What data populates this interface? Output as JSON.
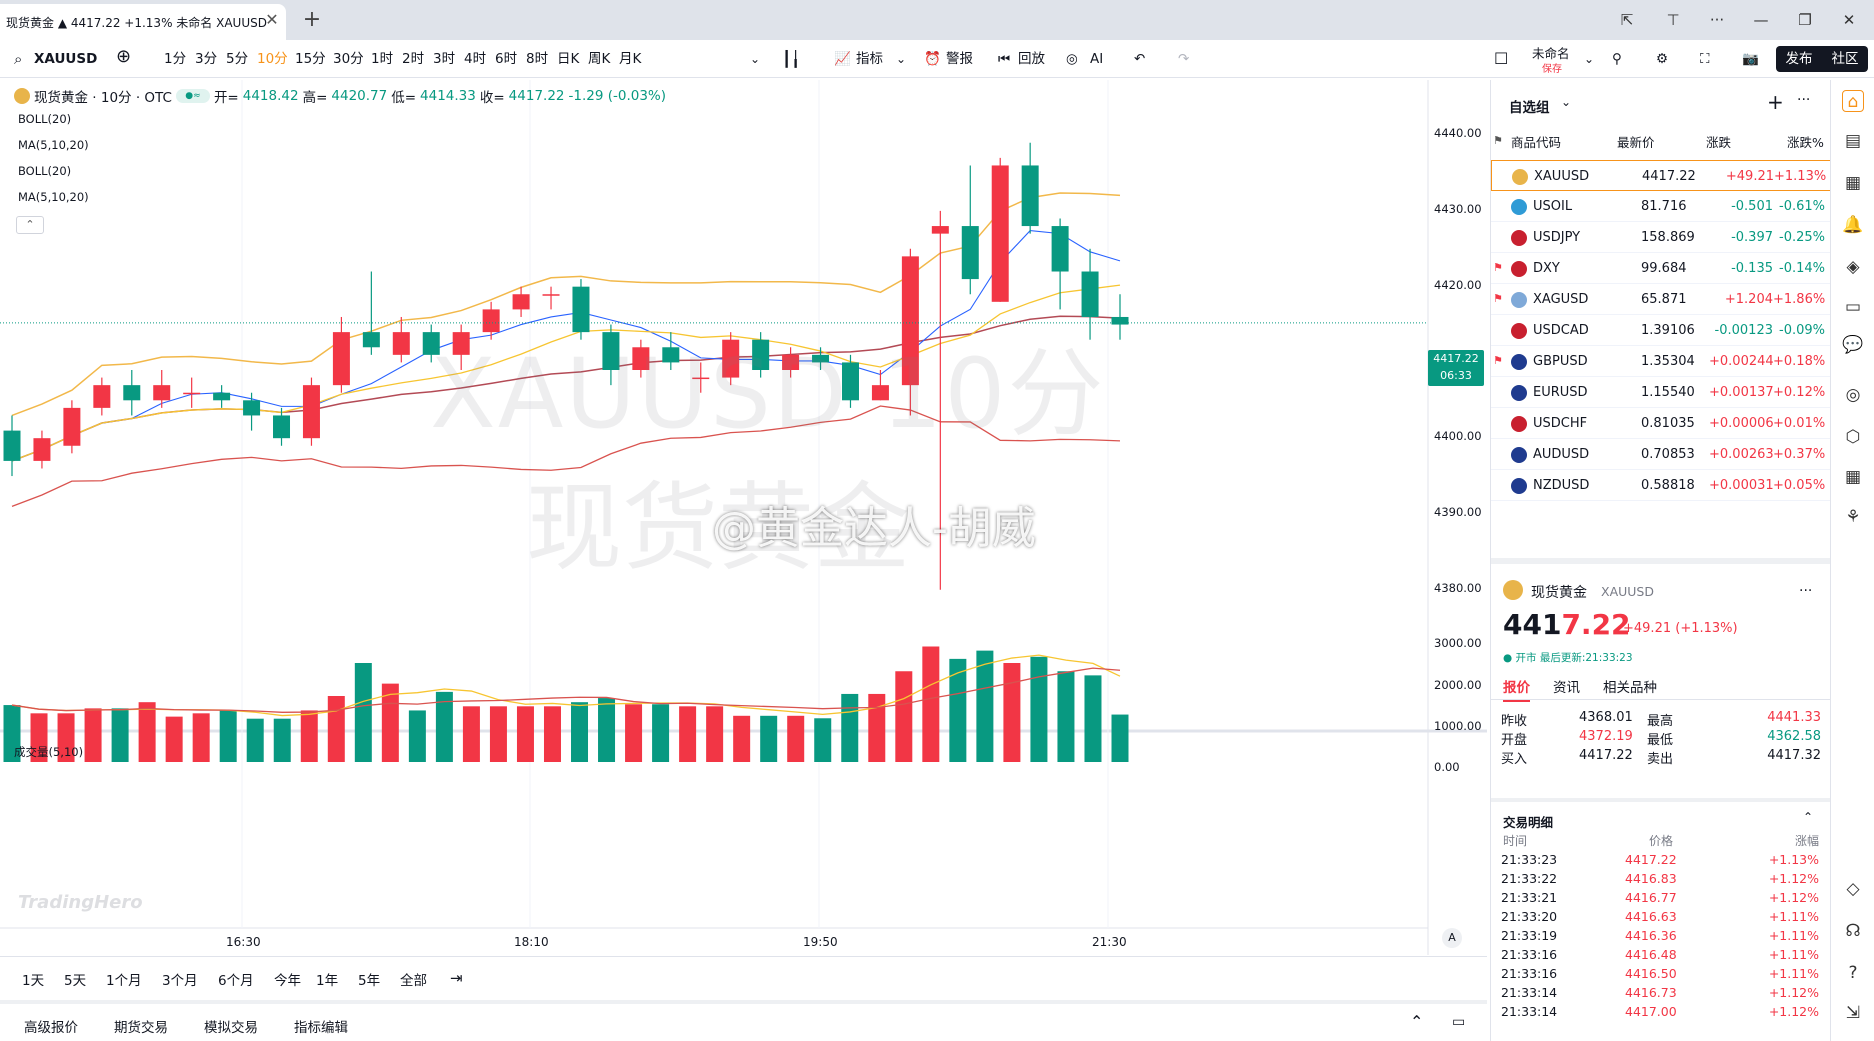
{
  "tab": {
    "title": "现货黄金 ▲ 4417.22 +1.13% 未命名 XAUUSD"
  },
  "toolbar": {
    "symbol": "XAUUSD",
    "intervals": [
      "1分",
      "3分",
      "5分",
      "10分",
      "15分",
      "30分",
      "1时",
      "2时",
      "3时",
      "4时",
      "6时",
      "8时",
      "日K",
      "周K",
      "月K"
    ],
    "active_interval": "10分",
    "indicators_label": "指标",
    "alert_label": "警报",
    "replay_label": "回放",
    "ai_label": "AI",
    "layout_name": "未命名",
    "layout_status": "保存",
    "publish_label": "发布",
    "community_label": "社区"
  },
  "legend": {
    "name": "现货黄金 · 10分 · OTC",
    "open_label": "开=",
    "open": "4418.42",
    "high_label": "高=",
    "high": "4420.77",
    "low_label": "低=",
    "low": "4414.33",
    "close_label": "收=",
    "close": "4417.22",
    "change": "-1.29 (-0.03%)"
  },
  "indicators": [
    "BOLL(20)",
    "MA(5,10,20)",
    "BOLL(20)",
    "MA(5,10,20)"
  ],
  "volume_label": "成交量(5,10)",
  "watermark": {
    "line1": "XAUUSD 10分",
    "line2": "现货黄金",
    "weibo": "@黄金达人-胡威"
  },
  "tradinghero": "TradingHero",
  "price_tag": {
    "price": "4417.22",
    "countdown": "06:33"
  },
  "price_axis": [
    "4440.00",
    "4430.00",
    "4420.00",
    "4410.00",
    "4400.00",
    "4390.00",
    "4380.00"
  ],
  "volume_axis": [
    "3000.00",
    "2000.00",
    "1000.00",
    "0.00"
  ],
  "time_axis": [
    "16:30",
    "18:10",
    "19:50",
    "21:30"
  ],
  "time_axis_btn": "A",
  "ranges": [
    "1天",
    "5天",
    "1个月",
    "3个月",
    "6个月",
    "今年",
    "1年",
    "5年",
    "全部"
  ],
  "bottom_tabs": [
    "高级报价",
    "期货交易",
    "模拟交易",
    "指标编辑"
  ],
  "chart_data": {
    "type": "candlestick",
    "ylim": [
      4378,
      4444
    ],
    "vol_ylim": [
      0,
      3200
    ],
    "candles": [
      [
        4403,
        4399,
        4405,
        4397
      ],
      [
        4399,
        4402,
        4403,
        4398
      ],
      [
        4401,
        4406,
        4407,
        4400
      ],
      [
        4406,
        4409,
        4410,
        4405
      ],
      [
        4409,
        4407,
        4411,
        4405
      ],
      [
        4407,
        4409,
        4411,
        4406
      ],
      [
        4408,
        4408,
        4410,
        4406
      ],
      [
        4408,
        4407,
        4409,
        4406
      ],
      [
        4407,
        4405,
        4408,
        4403
      ],
      [
        4405,
        4402,
        4406,
        4401
      ],
      [
        4402,
        4409,
        4410,
        4401
      ],
      [
        4409,
        4416,
        4418,
        4408
      ],
      [
        4416,
        4414,
        4424,
        4413
      ],
      [
        4413,
        4416,
        4418,
        4412
      ],
      [
        4416,
        4413,
        4417,
        4412
      ],
      [
        4413,
        4416,
        4417,
        4411
      ],
      [
        4416,
        4419,
        4420,
        4415
      ],
      [
        4419,
        4421,
        4422,
        4418
      ],
      [
        4421,
        4421,
        4422,
        4419
      ],
      [
        4422,
        4416,
        4423,
        4415
      ],
      [
        4416,
        4411,
        4417,
        4409
      ],
      [
        4411,
        4414,
        4415,
        4410
      ],
      [
        4414,
        4412,
        4416,
        4411
      ],
      [
        4410,
        4410,
        4412,
        4408
      ],
      [
        4410,
        4415,
        4416,
        4409
      ],
      [
        4415,
        4411,
        4416,
        4410
      ],
      [
        4411,
        4413,
        4414,
        4410
      ],
      [
        4413,
        4412,
        4414,
        4411
      ],
      [
        4412,
        4407,
        4413,
        4406
      ],
      [
        4407,
        4409,
        4411,
        4407
      ],
      [
        4409,
        4426,
        4427,
        4405
      ],
      [
        4429,
        4430,
        4432,
        4382
      ],
      [
        4430,
        4423,
        4438,
        4421
      ],
      [
        4420,
        4438,
        4439,
        4420
      ],
      [
        4438,
        4430,
        4441,
        4429
      ],
      [
        4430,
        4424,
        4431,
        4419
      ],
      [
        4424,
        4418,
        4427,
        4415
      ],
      [
        4418,
        4417,
        4421,
        4415
      ]
    ],
    "volume": [
      1380,
      1180,
      1180,
      1300,
      1300,
      1450,
      1100,
      1180,
      1250,
      1050,
      1050,
      1250,
      1600,
      2400,
      1900,
      1250,
      1700,
      1350,
      1350,
      1350,
      1350,
      1450,
      1550,
      1400,
      1400,
      1350,
      1350,
      1120,
      1120,
      1120,
      1060,
      1650,
      1650,
      2200,
      2800,
      2500,
      2700,
      2400,
      2550,
      2200,
      2100,
      1150
    ],
    "vol_up_color": "#089981",
    "vol_down_color": "#f23645"
  },
  "watchlist": {
    "title": "自选组",
    "headers": [
      "商品代码",
      "最新价",
      "涨跌",
      "涨跌%"
    ],
    "rows": [
      {
        "sym": "XAUUSD",
        "price": "4417.22",
        "chg": "+49.21",
        "pct": "+1.13%",
        "dir": "up",
        "flag": false,
        "color": "#e8b44a"
      },
      {
        "sym": "USOIL",
        "price": "81.716",
        "chg": "-0.501",
        "pct": "-0.61%",
        "dir": "down",
        "flag": false,
        "color": "#2f9bd6"
      },
      {
        "sym": "USDJPY",
        "price": "158.869",
        "chg": "-0.397",
        "pct": "-0.25%",
        "dir": "down",
        "flag": false,
        "color": "#c8202f"
      },
      {
        "sym": "DXY",
        "price": "99.684",
        "chg": "-0.135",
        "pct": "-0.14%",
        "dir": "down",
        "flag": true,
        "color": "#c8202f"
      },
      {
        "sym": "XAGUSD",
        "price": "65.871",
        "chg": "+1.204",
        "pct": "+1.86%",
        "dir": "up",
        "flag": true,
        "color": "#7fa9d8"
      },
      {
        "sym": "USDCAD",
        "price": "1.39106",
        "chg": "-0.00123",
        "pct": "-0.09%",
        "dir": "down",
        "flag": false,
        "color": "#c8202f"
      },
      {
        "sym": "GBPUSD",
        "price": "1.35304",
        "chg": "+0.00244",
        "pct": "+0.18%",
        "dir": "up",
        "flag": true,
        "color": "#1f3b8f"
      },
      {
        "sym": "EURUSD",
        "price": "1.15540",
        "chg": "+0.00137",
        "pct": "+0.12%",
        "dir": "up",
        "flag": false,
        "color": "#1f3b8f"
      },
      {
        "sym": "USDCHF",
        "price": "0.81035",
        "chg": "+0.00006",
        "pct": "+0.01%",
        "dir": "up",
        "flag": false,
        "color": "#c8202f"
      },
      {
        "sym": "AUDUSD",
        "price": "0.70853",
        "chg": "+0.00263",
        "pct": "+0.37%",
        "dir": "up",
        "flag": false,
        "color": "#1f3b8f"
      },
      {
        "sym": "NZDUSD",
        "price": "0.58818",
        "chg": "+0.00031",
        "pct": "+0.05%",
        "dir": "up",
        "flag": false,
        "color": "#1f3b8f"
      }
    ]
  },
  "detail": {
    "name": "现货黄金",
    "code": "XAUUSD",
    "price_main": "441",
    "price_tail": "7.22",
    "change": "+49.21 (+1.13%)",
    "status": "● 开市 最后更新:21:33:23",
    "tabs": [
      "报价",
      "资讯",
      "相关品种"
    ],
    "quote": [
      {
        "l1": "昨收",
        "v1": "4368.01",
        "l2": "最高",
        "v2": "4441.33",
        "c1": "",
        "c2": "red"
      },
      {
        "l1": "开盘",
        "v1": "4372.19",
        "l2": "最低",
        "v2": "4362.58",
        "c1": "red",
        "c2": "green"
      },
      {
        "l1": "买入",
        "v1": "4417.22",
        "l2": "卖出",
        "v2": "4417.32",
        "c1": "",
        "c2": ""
      }
    ],
    "trades_title": "交易明细",
    "trades_headers": [
      "时间",
      "价格",
      "涨幅"
    ],
    "trades": [
      [
        "21:33:23",
        "4417.22",
        "+1.13%"
      ],
      [
        "21:33:22",
        "4416.83",
        "+1.12%"
      ],
      [
        "21:33:21",
        "4416.77",
        "+1.12%"
      ],
      [
        "21:33:20",
        "4416.63",
        "+1.11%"
      ],
      [
        "21:33:19",
        "4416.36",
        "+1.11%"
      ],
      [
        "21:33:16",
        "4416.48",
        "+1.11%"
      ],
      [
        "21:33:16",
        "4416.50",
        "+1.11%"
      ],
      [
        "21:33:14",
        "4416.73",
        "+1.12%"
      ],
      [
        "21:33:14",
        "4417.00",
        "+1.12%"
      ]
    ]
  }
}
